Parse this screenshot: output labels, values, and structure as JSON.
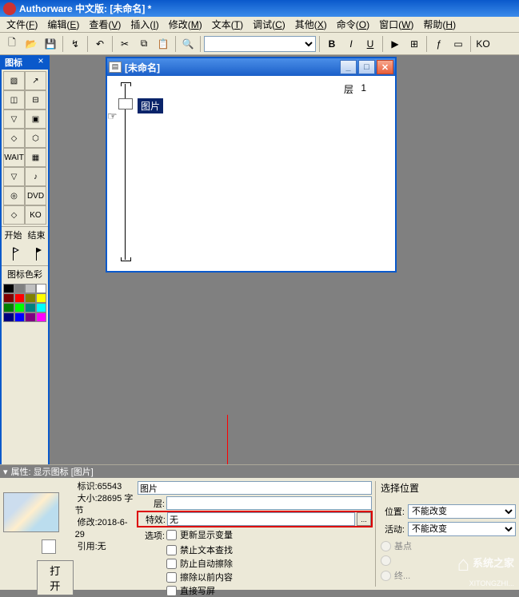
{
  "app_title": "Authorware 中文版: [未命名] *",
  "menus": [
    {
      "label": "文件",
      "key": "F"
    },
    {
      "label": "编辑",
      "key": "E"
    },
    {
      "label": "查看",
      "key": "V"
    },
    {
      "label": "插入",
      "key": "I"
    },
    {
      "label": "修改",
      "key": "M"
    },
    {
      "label": "文本",
      "key": "T"
    },
    {
      "label": "调试",
      "key": "C"
    },
    {
      "label": "其他",
      "key": "X"
    },
    {
      "label": "命令",
      "key": "O"
    },
    {
      "label": "窗口",
      "key": "W"
    },
    {
      "label": "帮助",
      "key": "H"
    }
  ],
  "palette": {
    "title": "图标",
    "section_labels": {
      "start": "开始",
      "end": "结束"
    },
    "color_label": "图标色彩",
    "colors": [
      "#000000",
      "#808080",
      "#c0c0c0",
      "#ffffff",
      "#800000",
      "#ff0000",
      "#808000",
      "#ffff00",
      "#008000",
      "#00ff00",
      "#008080",
      "#00ffff",
      "#000080",
      "#0000ff",
      "#800080",
      "#ff00ff"
    ]
  },
  "design_window": {
    "title": "[未命名]",
    "icon_label": "图片",
    "layer_label": "层",
    "layer_value": "1"
  },
  "properties": {
    "panel_title": "属性: 显示图标 [图片]",
    "info": {
      "id_label": "标识:",
      "id_value": "65543",
      "size_label": "大小:",
      "size_value": "28695 字节",
      "mod_label": "修改:",
      "mod_value": "2018-6-29",
      "ref_label": "引用:",
      "ref_value": "无"
    },
    "open_button": "打开",
    "name_field": "图片",
    "layer_label": "层:",
    "layer_value": "",
    "effect_label": "特效:",
    "effect_value": "无",
    "options_label": "选项:",
    "checkboxes": [
      "更新显示变量",
      "禁止文本查找",
      "防止自动擦除",
      "擦除以前内容",
      "直接写屏"
    ],
    "select_pos_label": "选择位置",
    "position_label": "位置:",
    "position_value": "不能改变",
    "activity_label": "活动:",
    "activity_value": "不能改变",
    "radio_base": "基点",
    "radio_end": "终..."
  },
  "watermark": {
    "brand": "系统之家",
    "sub": "XITONGZHI..."
  }
}
